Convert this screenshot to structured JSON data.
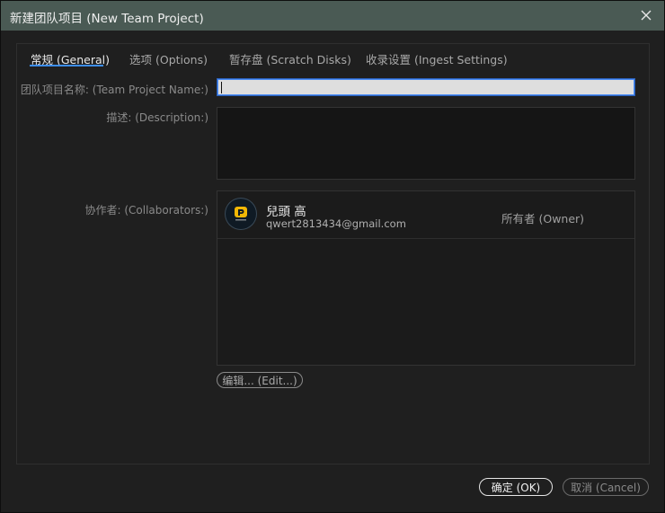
{
  "window": {
    "title": "新建团队项目 (New Team Project)"
  },
  "tabs": [
    {
      "label": "常规 (General)",
      "active": true
    },
    {
      "label": "选项 (Options)",
      "active": false
    },
    {
      "label": "暂存盘 (Scratch Disks)",
      "active": false
    },
    {
      "label": "收录设置 (Ingest Settings)",
      "active": false
    }
  ],
  "form": {
    "name_label": "团队项目名称: (Team Project Name:)",
    "name_value": "",
    "description_label": "描述: (Description:)",
    "description_value": "",
    "collaborators_label": "协作者: (Collaborators:)"
  },
  "collaborators": [
    {
      "name": "兒頭 高",
      "email": "qwert2813434@gmail.com",
      "role": "所有者 (Owner)"
    }
  ],
  "buttons": {
    "edit": "编辑... (Edit...)",
    "ok": "确定 (OK)",
    "cancel": "取消 (Cancel)"
  },
  "colors": {
    "titlebar": "#4a5a54",
    "accent": "#3d8ef0",
    "avatar_logo": "#f2b705"
  }
}
